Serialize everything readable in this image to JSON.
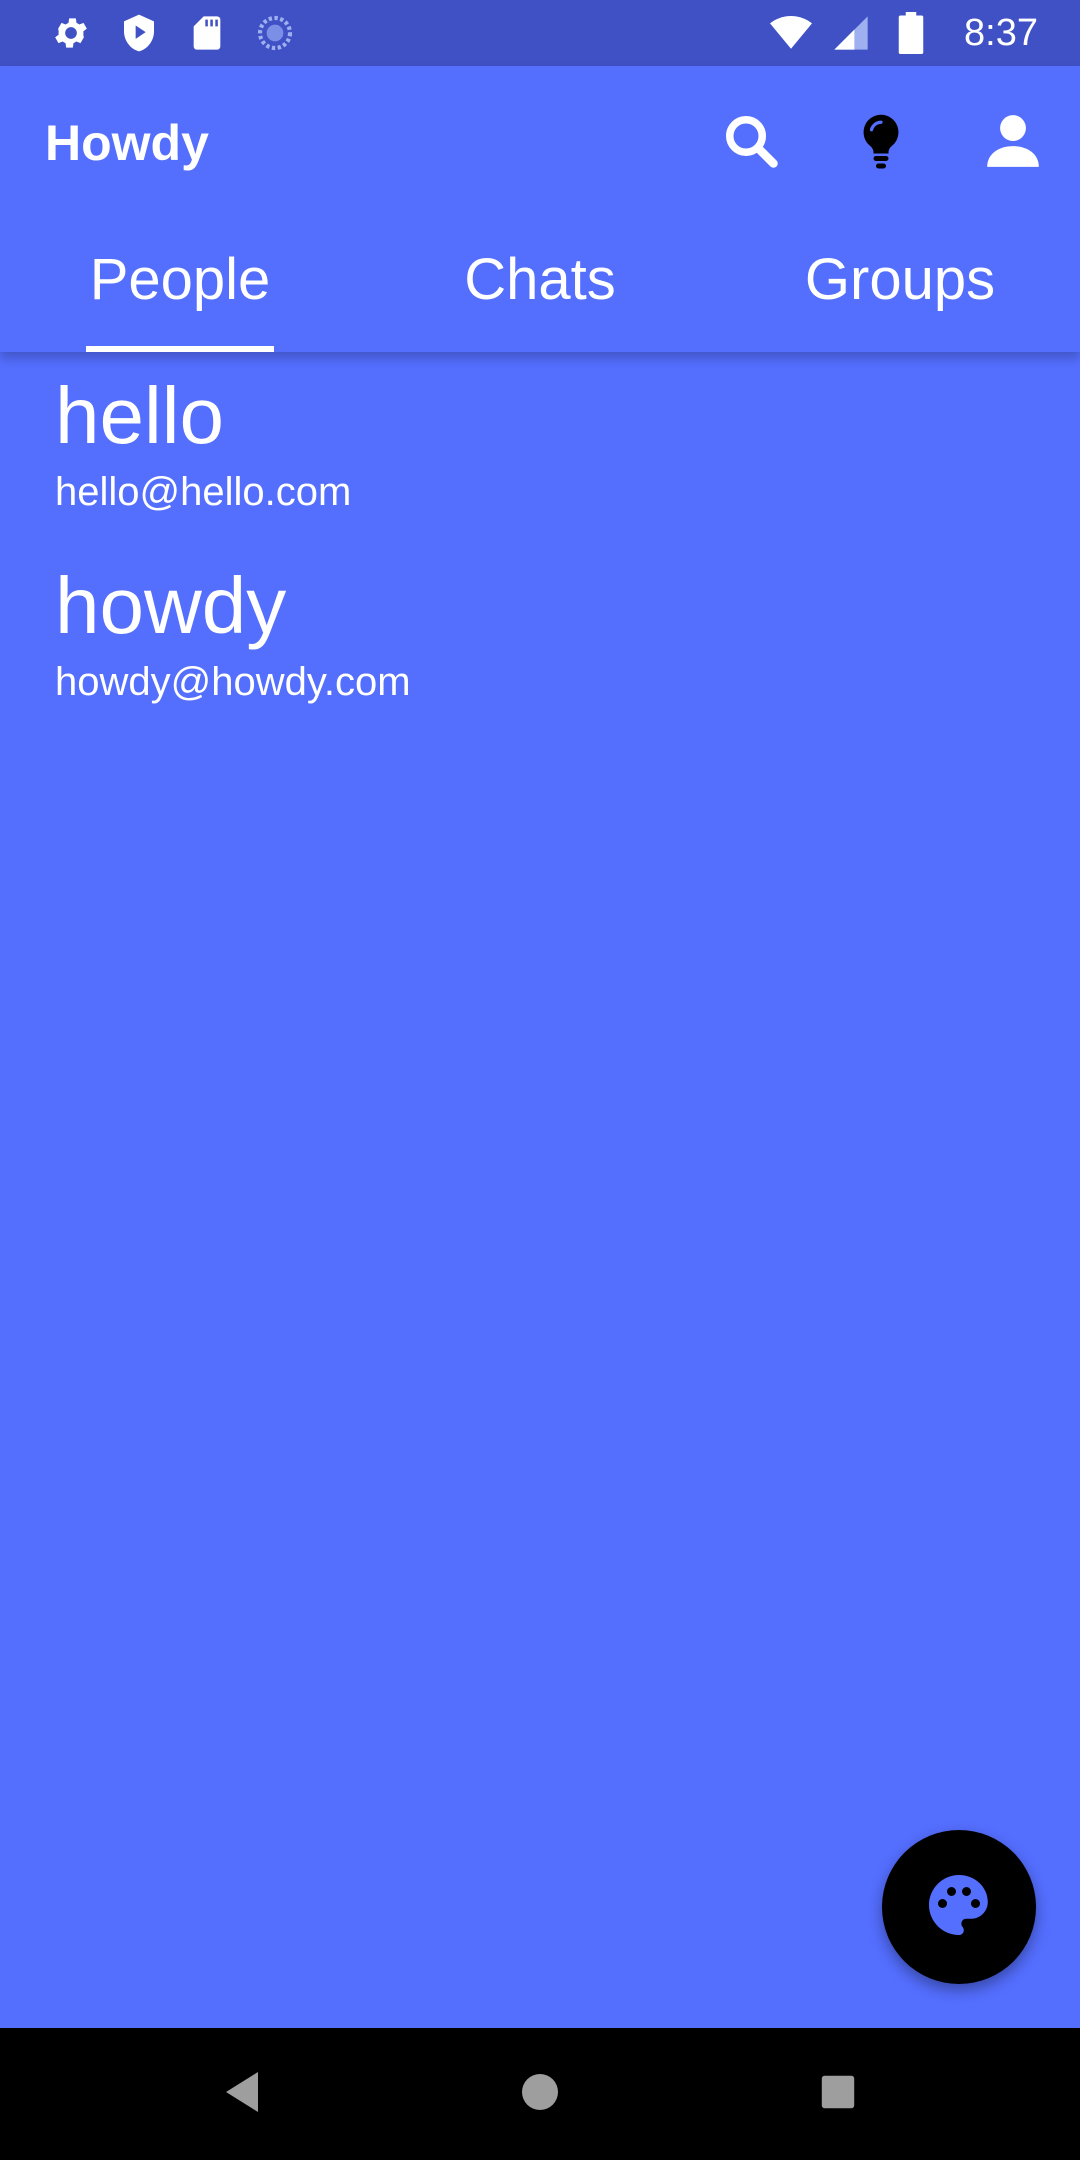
{
  "status_bar": {
    "time": "8:37",
    "left_icons": [
      "gear-icon",
      "shield-play-icon",
      "sd-card-icon",
      "sync-icon"
    ],
    "right_icons": [
      "wifi-icon",
      "signal-icon",
      "battery-icon"
    ]
  },
  "app_bar": {
    "title": "Howdy",
    "actions": [
      "search-icon",
      "lightbulb-icon",
      "account-icon"
    ]
  },
  "tabs": [
    {
      "label": "People",
      "selected": true
    },
    {
      "label": "Chats",
      "selected": false
    },
    {
      "label": "Groups",
      "selected": false
    }
  ],
  "people": [
    {
      "name": "hello",
      "email": "hello@hello.com"
    },
    {
      "name": "howdy",
      "email": "howdy@howdy.com"
    }
  ],
  "fab": {
    "icon": "palette-icon"
  },
  "nav_bar": {
    "buttons": [
      "back-icon",
      "home-icon",
      "recents-icon"
    ]
  },
  "colors": {
    "status_bar": "#3F51C4",
    "primary": "#546EFE",
    "fab": "#000000",
    "nav_bar": "#000000"
  }
}
